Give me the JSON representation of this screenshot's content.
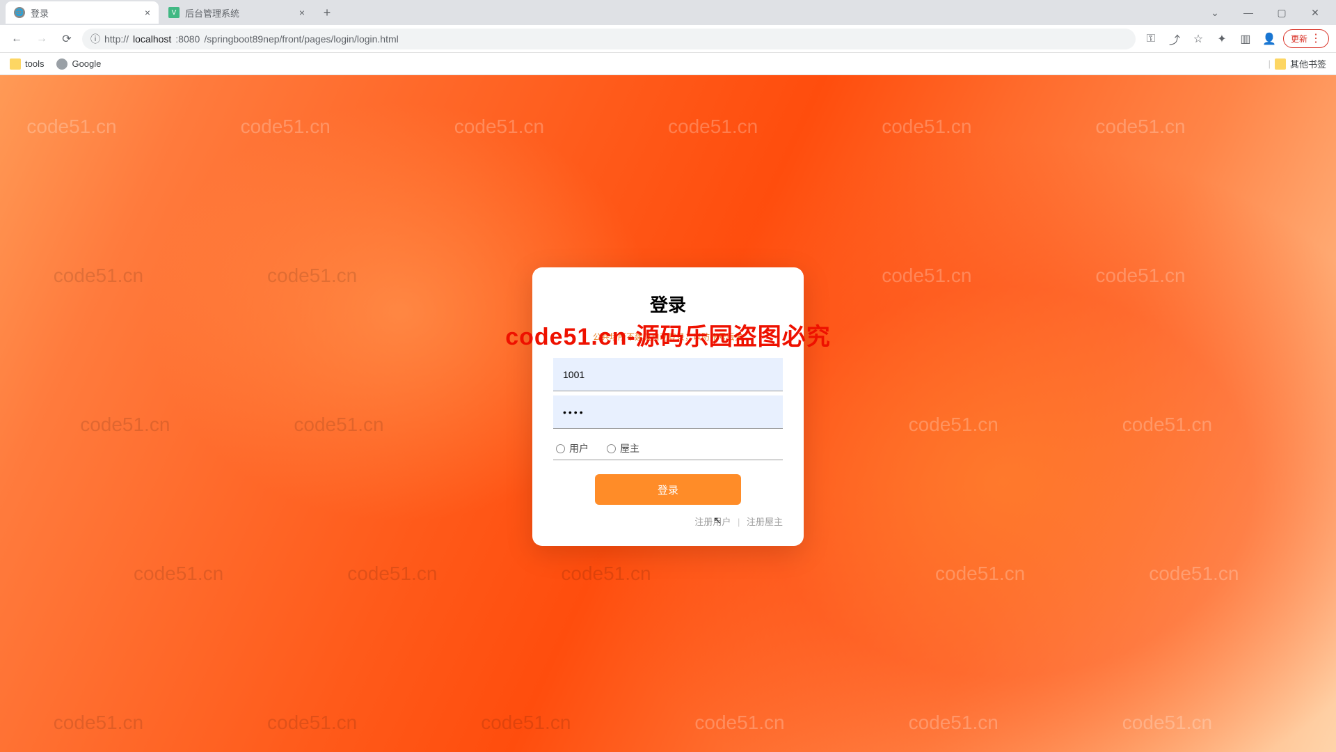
{
  "browser": {
    "tabs": [
      {
        "title": "登录",
        "favicon": "globe"
      },
      {
        "title": "后台管理系统",
        "favicon": "vue"
      }
    ],
    "url_info_icon": "ⓘ",
    "url_host": "localhost",
    "url_port": ":8080",
    "url_path": "/springboot89nep/front/pages/login/login.html",
    "update_label": "更新",
    "bookmarks": {
      "tools": "tools",
      "google": "Google",
      "other": "其他书签"
    }
  },
  "watermark": "code51.cn",
  "overlay": "code51.cn-源码乐园盗图必究",
  "login": {
    "title": "登录",
    "warn": "公共场所不建议自动登录，以防账号丢失",
    "username_value": "1001",
    "password_value": "••••",
    "role_user": "用户",
    "role_owner": "屋主",
    "submit": "登录",
    "register_user": "注册用户",
    "register_owner": "注册屋主"
  }
}
